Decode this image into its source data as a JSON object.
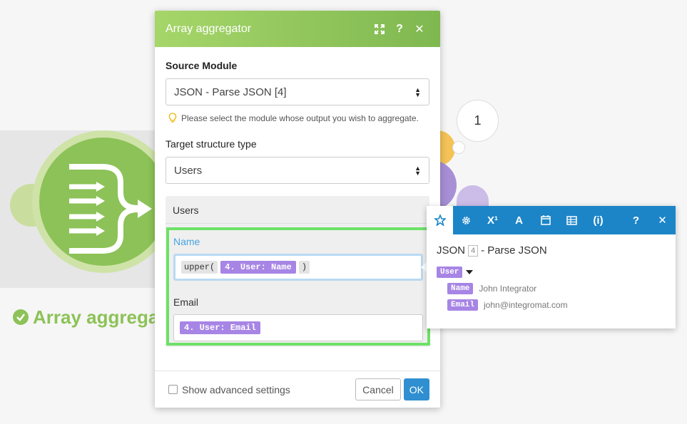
{
  "canvas": {
    "module_label": "Array aggrega",
    "bubble_count": "1"
  },
  "dialog": {
    "title": "Array aggregator",
    "source_module": {
      "label": "Source Module",
      "value": "JSON - Parse JSON [4]",
      "hint": "Please select the module whose output you wish to aggregate."
    },
    "target_structure": {
      "label": "Target structure type",
      "value": "Users"
    },
    "panel": {
      "title": "Users",
      "name_field": {
        "label": "Name",
        "fn_open": "upper(",
        "var": "4. User: Name",
        "fn_close": ")"
      },
      "email_field": {
        "label": "Email",
        "var": "4. User: Email"
      }
    },
    "footer": {
      "advanced_label": "Show advanced settings",
      "cancel": "Cancel",
      "ok": "OK"
    }
  },
  "mapping_panel": {
    "title_prefix": "JSON",
    "title_num": "4",
    "title_suffix": "- Parse JSON",
    "root_key": "User",
    "children": [
      {
        "key": "Name",
        "value": "John Integrator"
      },
      {
        "key": "Email",
        "value": "john@integromat.com"
      }
    ]
  },
  "colors": {
    "accent_green": "#8cc257",
    "toolbar_blue": "#1c85c8",
    "pill_purple": "#a785e5",
    "ok_blue": "#2f8fd0",
    "highlight": "#6de167"
  }
}
